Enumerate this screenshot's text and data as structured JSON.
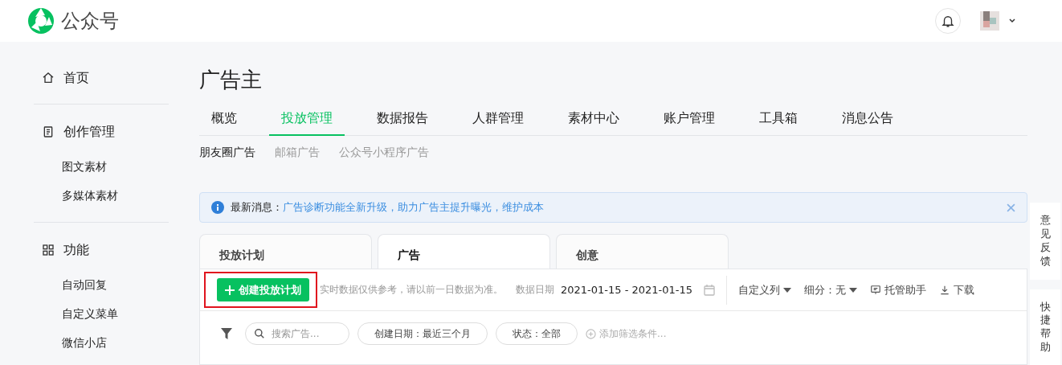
{
  "header": {
    "logo_text": "公众号"
  },
  "sidebar": {
    "sections": [
      {
        "kind": "home",
        "label": "首页"
      },
      {
        "kind": "document",
        "label": "创作管理",
        "items": [
          "图文素材",
          "多媒体素材"
        ]
      },
      {
        "kind": "grid",
        "label": "功能",
        "items": [
          "自动回复",
          "自定义菜单",
          "微信小店"
        ]
      }
    ]
  },
  "page_title": "广告主",
  "main_tabs": [
    {
      "label": "概览",
      "selected": false
    },
    {
      "label": "投放管理",
      "selected": true
    },
    {
      "label": "数据报告",
      "selected": false
    },
    {
      "label": "人群管理",
      "selected": false
    },
    {
      "label": "素材中心",
      "selected": false
    },
    {
      "label": "账户管理",
      "selected": false
    },
    {
      "label": "工具箱",
      "selected": false
    },
    {
      "label": "消息公告",
      "selected": false
    }
  ],
  "sub_tabs": [
    {
      "label": "朋友圈广告",
      "selected": true
    },
    {
      "label": "邮箱广告",
      "selected": false
    },
    {
      "label": "公众号小程序广告",
      "selected": false
    }
  ],
  "notice": {
    "label": "最新消息：",
    "text": "广告诊断功能全新升级，助力广告主提升曝光，维护成本"
  },
  "panel_tabs": [
    {
      "label": "投放计划",
      "selected": false
    },
    {
      "label": "广告",
      "selected": true
    },
    {
      "label": "创意",
      "selected": false
    }
  ],
  "toolbar": {
    "create_button": "创建投放计划",
    "hint": "实时数据仅供参考，请以前一日数据为准。",
    "date_label": "数据日期",
    "date_range": "2021-01-15 - 2021-01-15",
    "actions": [
      {
        "kind": "dropdown",
        "label": "自定义列"
      },
      {
        "kind": "dropdown",
        "label": "细分：无"
      },
      {
        "kind": "assistant",
        "label": "托管助手"
      },
      {
        "kind": "download",
        "label": "下载"
      }
    ]
  },
  "filters": {
    "search_placeholder": "搜索广告...",
    "chips": [
      "创建日期：最近三个月",
      "状态：全部"
    ],
    "add_filter": "添加筛选条件..."
  },
  "side_tabs": [
    "意见反馈",
    "快捷帮助"
  ]
}
